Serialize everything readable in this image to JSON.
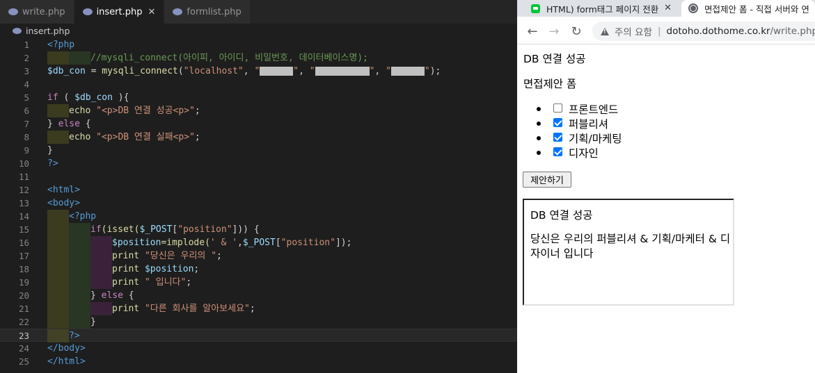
{
  "editor": {
    "tabs": [
      {
        "label": "write.php",
        "active": false
      },
      {
        "label": "insert.php",
        "active": true,
        "close": "✕"
      },
      {
        "label": "formlist.php",
        "active": false
      }
    ],
    "breadcrumb": "insert.php",
    "current_line": 23,
    "line_numbers": [
      "1",
      "2",
      "3",
      "4",
      "5",
      "6",
      "7",
      "8",
      "9",
      "10",
      "11",
      "12",
      "13",
      "14",
      "15",
      "16",
      "17",
      "18",
      "19",
      "20",
      "21",
      "22",
      "23",
      "24",
      "25"
    ],
    "code": {
      "l1": "<?php",
      "l2": "//mysqli_connect(아이피, 아이디, 비밀번호, 데이터베이스명);",
      "l3_var": "$db_con",
      "l3_eq": " = ",
      "l3_fn": "mysqli_connect",
      "l3_open": "(",
      "l3_host": "\"localhost\"",
      "l3_comma": ", ",
      "l3_end": ");",
      "l5_if": "if",
      "l5_open": " ( ",
      "l5_var": "$db_con",
      "l5_close": " ){",
      "l6_echo": "echo ",
      "l6_str": "\"<p>DB 연결 성공<p>\"",
      "l6_end": ";",
      "l7_close": "} ",
      "l7_else": "else",
      "l7_brace": " {",
      "l8_echo": "echo ",
      "l8_str": "\"<p>DB 연결 실패<p>\"",
      "l8_end": ";",
      "l9": "}",
      "l10": "?>",
      "l12": "<html>",
      "l13": "<body>",
      "l14": "<?php",
      "l15_if": "if",
      "l15_fn": "(isset(",
      "l15_var": "$_POST",
      "l15_br1": "[",
      "l15_str": "\"position\"",
      "l15_br2": "])) {",
      "l16_var": "$position",
      "l16_eq": "=implode(",
      "l16_str": "' & '",
      "l16_comma": ",",
      "l16_var2": "$_POST",
      "l16_br1": "[",
      "l16_str2": "\"position\"",
      "l16_end": "]);",
      "l17_print": "print ",
      "l17_str": "\"당신은 우리의 \"",
      "l17_end": ";",
      "l18_print": "print ",
      "l18_var": "$position",
      "l18_end": ";",
      "l19_print": "print ",
      "l19_str": "\" 입니다\"",
      "l19_end": ";",
      "l20_close": "} ",
      "l20_else": "else",
      "l20_brace": " {",
      "l21_print": "print ",
      "l21_str": "\"다른 회사를 알아보세요\"",
      "l21_end": ";",
      "l22": "}",
      "l23": "?>",
      "l24": "</body>",
      "l25": "</html>"
    }
  },
  "browser": {
    "tabs": [
      {
        "title": "HTML) form태그 페이지 전환",
        "close": "✕"
      },
      {
        "title": "면접제안 폼 - 직접 서버와 연"
      }
    ],
    "nav": {
      "back": "←",
      "forward": "→",
      "reload": "↻"
    },
    "omnibox": {
      "security_text": "주의 요함",
      "separator": "|",
      "host": "dotoho.dothome.co.kr",
      "path": "/write.php"
    },
    "page": {
      "db_status": "DB 연결 성공",
      "form_title": "면접제안 폼",
      "options": [
        {
          "label": "프론트엔드",
          "checked": false
        },
        {
          "label": "퍼블리셔",
          "checked": true
        },
        {
          "label": "기획/마케팅",
          "checked": true
        },
        {
          "label": "디자인",
          "checked": true
        }
      ],
      "submit_label": "제안하기",
      "result": {
        "db_status": "DB 연결 성공",
        "message": "당신은 우리의 퍼블리셔 & 기획/마케터 & 디자이너 입니다"
      }
    }
  },
  "colors": {
    "editor_bg": "#1e1e1e",
    "keyword_blue": "#569cd6",
    "control_purple": "#c586c0",
    "variable": "#9cdcfe",
    "string": "#ce9178",
    "comment": "#6a9955",
    "function": "#dcdcaa",
    "php_icon": "#8892bf",
    "checkbox_checked": "#0075ff"
  }
}
